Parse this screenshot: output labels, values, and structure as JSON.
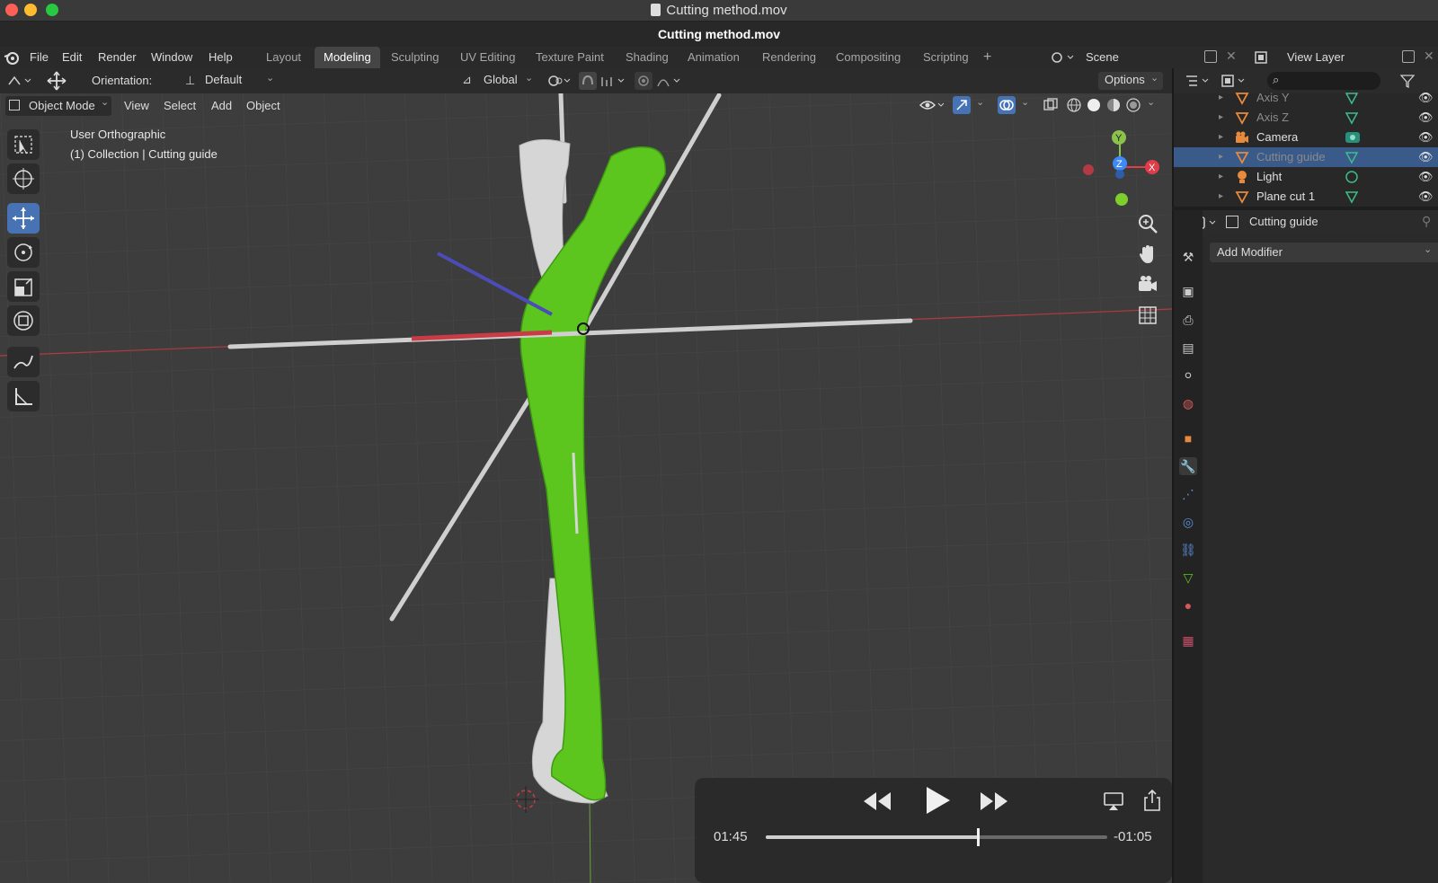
{
  "window": {
    "title": "Cutting method.mov",
    "subtitle": "Cutting method.mov"
  },
  "menu": [
    "File",
    "Edit",
    "Render",
    "Window",
    "Help"
  ],
  "workspaces": [
    {
      "label": "Layout",
      "active": false
    },
    {
      "label": "Modeling",
      "active": true
    },
    {
      "label": "Sculpting",
      "active": false
    },
    {
      "label": "UV Editing",
      "active": false
    },
    {
      "label": "Texture Paint",
      "active": false
    },
    {
      "label": "Shading",
      "active": false
    },
    {
      "label": "Animation",
      "active": false
    },
    {
      "label": "Rendering",
      "active": false
    },
    {
      "label": "Compositing",
      "active": false
    },
    {
      "label": "Scripting",
      "active": false
    }
  ],
  "scene": {
    "label": "Scene",
    "view_layer": "View Layer"
  },
  "toolheader": {
    "orientation_label": "Orientation:",
    "orientation_value": "Default",
    "transform_space": "Global",
    "options_label": "Options"
  },
  "viewport_header": {
    "mode": "Object Mode",
    "menus": [
      "View",
      "Select",
      "Add",
      "Object"
    ]
  },
  "viewport": {
    "view_name": "User Orthographic",
    "collection_info": "(1) Collection | Cutting guide",
    "gizmo": {
      "x": "X",
      "y": "Y",
      "z": "Z"
    }
  },
  "outliner": {
    "items": [
      {
        "label": "Axis Y",
        "icon": "mesh-icon",
        "selected": false,
        "dim": true
      },
      {
        "label": "Axis Z",
        "icon": "mesh-icon",
        "selected": false,
        "dim": true
      },
      {
        "label": "Camera",
        "icon": "camera-icon",
        "selected": false,
        "dim": false
      },
      {
        "label": "Cutting guide",
        "icon": "mesh-icon",
        "selected": true,
        "dim": true
      },
      {
        "label": "Light",
        "icon": "light-icon",
        "selected": false,
        "dim": false
      },
      {
        "label": "Plane cut 1",
        "icon": "mesh-icon",
        "selected": false,
        "dim": false
      }
    ]
  },
  "properties": {
    "object_name": "Cutting guide",
    "add_modifier": "Add Modifier"
  },
  "player": {
    "elapsed": "01:45",
    "remaining": "-01:05",
    "progress": 0.62
  },
  "colors": {
    "accent": "#4772b3",
    "model_green": "#5cc61e",
    "bone_white": "#d8d8d8",
    "x_axis": "#e03c4a"
  }
}
